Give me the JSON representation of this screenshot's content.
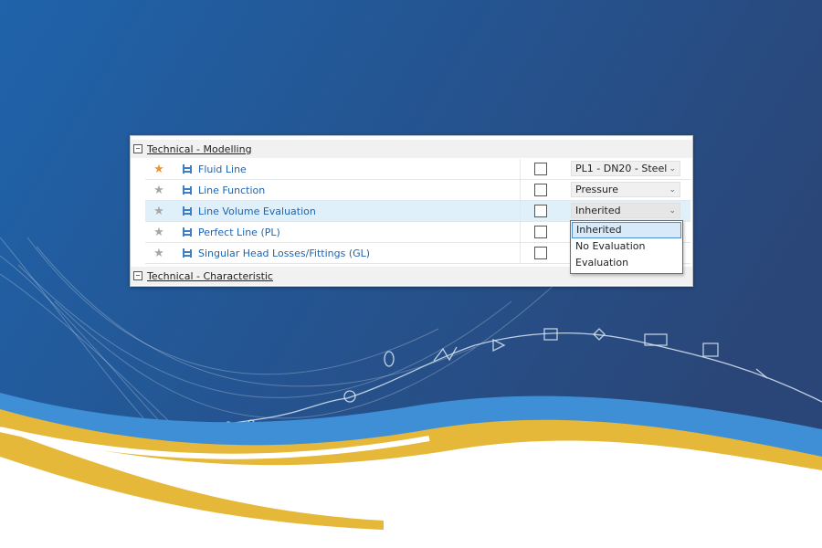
{
  "colors": {
    "accent_blue": "#1f64b0",
    "star_favorite": "#f0932b",
    "star_default": "#a6a6a6",
    "selection_bg": "#dff0fb",
    "wave_yellow": "#e5b83a",
    "wave_blue": "#3e8fd6"
  },
  "panel": {
    "groups": [
      {
        "title": "Technical - Modelling",
        "toggle": "−"
      },
      {
        "title": "Technical - Characteristic",
        "toggle": "−"
      }
    ],
    "rows": [
      {
        "label": "Fluid Line",
        "favorite": true,
        "checked": false,
        "value": "PL1 - DN20 - Steel",
        "icon": "line-icon"
      },
      {
        "label": "Line Function",
        "favorite": false,
        "checked": false,
        "value": "Pressure",
        "icon": "line-icon"
      },
      {
        "label": "Line Volume Evaluation",
        "favorite": false,
        "checked": false,
        "value": "Inherited",
        "icon": "line-icon",
        "selected": true
      },
      {
        "label": "Perfect Line (PL)",
        "favorite": false,
        "checked": false,
        "value": "",
        "icon": "line-icon"
      },
      {
        "label": "Singular Head Losses/Fittings (GL)",
        "favorite": false,
        "checked": false,
        "value": "",
        "icon": "line-icon"
      }
    ]
  },
  "dropdown": {
    "options": [
      "Inherited",
      "No Evaluation",
      "Evaluation"
    ],
    "selected": "Inherited"
  }
}
